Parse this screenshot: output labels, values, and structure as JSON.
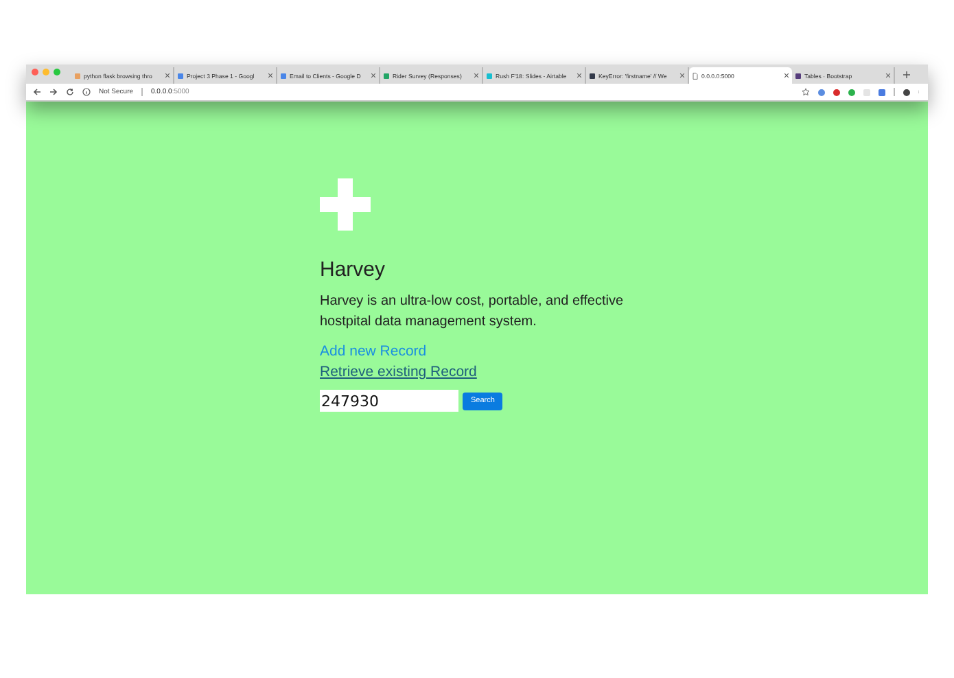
{
  "browser": {
    "tabs": [
      {
        "title": "python flask browsing thro",
        "selected": false,
        "color": "#e8a060"
      },
      {
        "title": "Project 3 Phase 1 - Googl",
        "selected": false,
        "color": "#4a86e8"
      },
      {
        "title": "Email to Clients - Google D",
        "selected": false,
        "color": "#4a86e8"
      },
      {
        "title": "Rider Survey (Responses)",
        "selected": false,
        "color": "#23a566"
      },
      {
        "title": "Rush F'18: Slides - Airtable",
        "selected": false,
        "color": "#18bfd0"
      },
      {
        "title": "KeyError: 'firstname' // We",
        "selected": false,
        "color": "#333a4a"
      },
      {
        "title": "0.0.0.0:5000",
        "selected": true
      },
      {
        "title": "Tables · Bootstrap",
        "selected": false,
        "color": "#563d7c"
      }
    ],
    "security": "Not Secure",
    "url_host": "0.0.0.0",
    "url_port": ":5000"
  },
  "page": {
    "title": "Harvey",
    "description": "Harvey is an ultra-low cost, portable, and effective hostpital data management system.",
    "links": [
      {
        "label": "Add new Record",
        "visited": false
      },
      {
        "label": "Retrieve existing Record",
        "visited": true
      }
    ],
    "search": {
      "value": "247930",
      "button": "Search"
    }
  }
}
